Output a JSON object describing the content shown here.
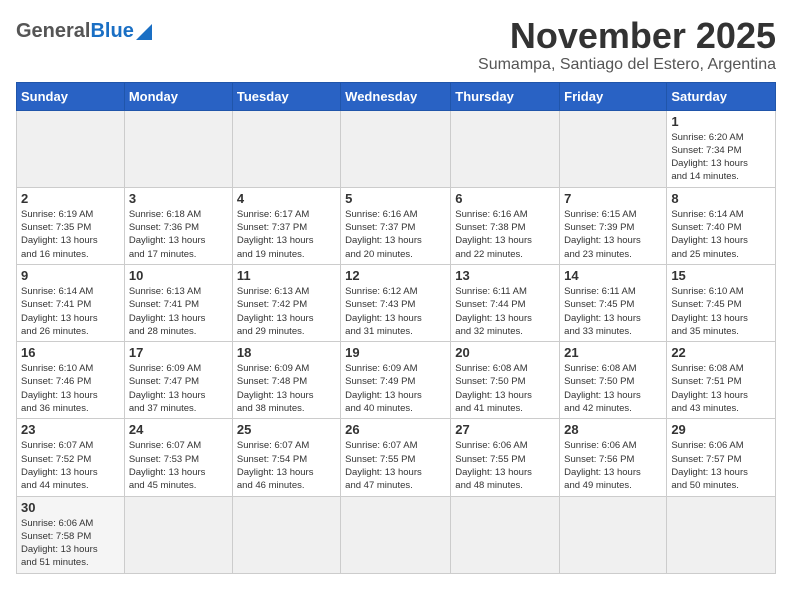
{
  "header": {
    "logo_general": "General",
    "logo_blue": "Blue",
    "month_title": "November 2025",
    "location": "Sumampa, Santiago del Estero, Argentina"
  },
  "weekdays": [
    "Sunday",
    "Monday",
    "Tuesday",
    "Wednesday",
    "Thursday",
    "Friday",
    "Saturday"
  ],
  "weeks": [
    [
      {
        "day": "",
        "info": ""
      },
      {
        "day": "",
        "info": ""
      },
      {
        "day": "",
        "info": ""
      },
      {
        "day": "",
        "info": ""
      },
      {
        "day": "",
        "info": ""
      },
      {
        "day": "",
        "info": ""
      },
      {
        "day": "1",
        "info": "Sunrise: 6:20 AM\nSunset: 7:34 PM\nDaylight: 13 hours\nand 14 minutes."
      }
    ],
    [
      {
        "day": "2",
        "info": "Sunrise: 6:19 AM\nSunset: 7:35 PM\nDaylight: 13 hours\nand 16 minutes."
      },
      {
        "day": "3",
        "info": "Sunrise: 6:18 AM\nSunset: 7:36 PM\nDaylight: 13 hours\nand 17 minutes."
      },
      {
        "day": "4",
        "info": "Sunrise: 6:17 AM\nSunset: 7:37 PM\nDaylight: 13 hours\nand 19 minutes."
      },
      {
        "day": "5",
        "info": "Sunrise: 6:16 AM\nSunset: 7:37 PM\nDaylight: 13 hours\nand 20 minutes."
      },
      {
        "day": "6",
        "info": "Sunrise: 6:16 AM\nSunset: 7:38 PM\nDaylight: 13 hours\nand 22 minutes."
      },
      {
        "day": "7",
        "info": "Sunrise: 6:15 AM\nSunset: 7:39 PM\nDaylight: 13 hours\nand 23 minutes."
      },
      {
        "day": "8",
        "info": "Sunrise: 6:14 AM\nSunset: 7:40 PM\nDaylight: 13 hours\nand 25 minutes."
      }
    ],
    [
      {
        "day": "9",
        "info": "Sunrise: 6:14 AM\nSunset: 7:41 PM\nDaylight: 13 hours\nand 26 minutes."
      },
      {
        "day": "10",
        "info": "Sunrise: 6:13 AM\nSunset: 7:41 PM\nDaylight: 13 hours\nand 28 minutes."
      },
      {
        "day": "11",
        "info": "Sunrise: 6:13 AM\nSunset: 7:42 PM\nDaylight: 13 hours\nand 29 minutes."
      },
      {
        "day": "12",
        "info": "Sunrise: 6:12 AM\nSunset: 7:43 PM\nDaylight: 13 hours\nand 31 minutes."
      },
      {
        "day": "13",
        "info": "Sunrise: 6:11 AM\nSunset: 7:44 PM\nDaylight: 13 hours\nand 32 minutes."
      },
      {
        "day": "14",
        "info": "Sunrise: 6:11 AM\nSunset: 7:45 PM\nDaylight: 13 hours\nand 33 minutes."
      },
      {
        "day": "15",
        "info": "Sunrise: 6:10 AM\nSunset: 7:45 PM\nDaylight: 13 hours\nand 35 minutes."
      }
    ],
    [
      {
        "day": "16",
        "info": "Sunrise: 6:10 AM\nSunset: 7:46 PM\nDaylight: 13 hours\nand 36 minutes."
      },
      {
        "day": "17",
        "info": "Sunrise: 6:09 AM\nSunset: 7:47 PM\nDaylight: 13 hours\nand 37 minutes."
      },
      {
        "day": "18",
        "info": "Sunrise: 6:09 AM\nSunset: 7:48 PM\nDaylight: 13 hours\nand 38 minutes."
      },
      {
        "day": "19",
        "info": "Sunrise: 6:09 AM\nSunset: 7:49 PM\nDaylight: 13 hours\nand 40 minutes."
      },
      {
        "day": "20",
        "info": "Sunrise: 6:08 AM\nSunset: 7:50 PM\nDaylight: 13 hours\nand 41 minutes."
      },
      {
        "day": "21",
        "info": "Sunrise: 6:08 AM\nSunset: 7:50 PM\nDaylight: 13 hours\nand 42 minutes."
      },
      {
        "day": "22",
        "info": "Sunrise: 6:08 AM\nSunset: 7:51 PM\nDaylight: 13 hours\nand 43 minutes."
      }
    ],
    [
      {
        "day": "23",
        "info": "Sunrise: 6:07 AM\nSunset: 7:52 PM\nDaylight: 13 hours\nand 44 minutes."
      },
      {
        "day": "24",
        "info": "Sunrise: 6:07 AM\nSunset: 7:53 PM\nDaylight: 13 hours\nand 45 minutes."
      },
      {
        "day": "25",
        "info": "Sunrise: 6:07 AM\nSunset: 7:54 PM\nDaylight: 13 hours\nand 46 minutes."
      },
      {
        "day": "26",
        "info": "Sunrise: 6:07 AM\nSunset: 7:55 PM\nDaylight: 13 hours\nand 47 minutes."
      },
      {
        "day": "27",
        "info": "Sunrise: 6:06 AM\nSunset: 7:55 PM\nDaylight: 13 hours\nand 48 minutes."
      },
      {
        "day": "28",
        "info": "Sunrise: 6:06 AM\nSunset: 7:56 PM\nDaylight: 13 hours\nand 49 minutes."
      },
      {
        "day": "29",
        "info": "Sunrise: 6:06 AM\nSunset: 7:57 PM\nDaylight: 13 hours\nand 50 minutes."
      }
    ],
    [
      {
        "day": "30",
        "info": "Sunrise: 6:06 AM\nSunset: 7:58 PM\nDaylight: 13 hours\nand 51 minutes."
      },
      {
        "day": "",
        "info": ""
      },
      {
        "day": "",
        "info": ""
      },
      {
        "day": "",
        "info": ""
      },
      {
        "day": "",
        "info": ""
      },
      {
        "day": "",
        "info": ""
      },
      {
        "day": "",
        "info": ""
      }
    ]
  ]
}
